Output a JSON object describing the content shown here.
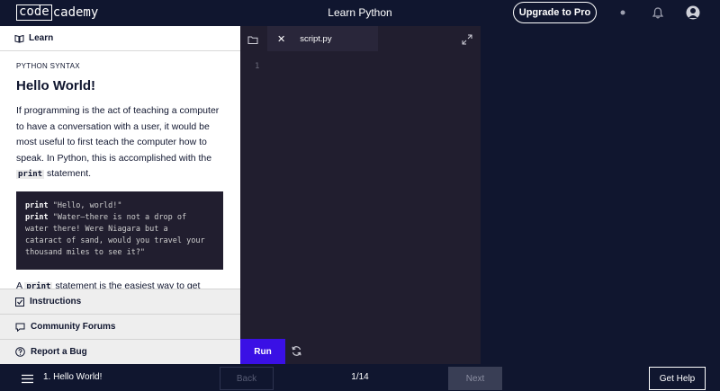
{
  "header": {
    "logo_box": "code",
    "logo_rest": "cademy",
    "title": "Learn Python",
    "upgrade_label": "Upgrade to Pro"
  },
  "sidebar": {
    "learn_label": "Learn",
    "kicker": "PYTHON SYNTAX",
    "title": "Hello World!",
    "para_before": "If programming is the act of teaching a computer to have a conversation with a user, it would be most useful to first teach the computer how to speak. In Python, this is accomplished with the ",
    "para_code": "print",
    "para_after": " statement.",
    "code_line1_kw": "print",
    "code_line1_str": " \"Hello, world!\"",
    "code_line2_kw": "print",
    "code_line2_str": " \"Water—there is not a drop of\nwater there! Were Niagara but a\ncataract of sand, would you travel your\nthousand miles to see it?\"",
    "next_prefix": "A ",
    "next_code": "print",
    "next_suffix": " statement is the easiest way to get",
    "instructions_label": "Instructions",
    "forums_label": "Community Forums",
    "bug_label": "Report a Bug"
  },
  "editor": {
    "tab_name": "script.py",
    "line_number": "1",
    "run_label": "Run"
  },
  "footer": {
    "lesson_label": "1. Hello World!",
    "back_label": "Back",
    "progress": "1/14",
    "next_label": "Next",
    "help_label": "Get Help"
  },
  "colors": {
    "navy": "#10162f",
    "editor_bg": "#211e2f",
    "run_purple": "#3a10e5"
  }
}
